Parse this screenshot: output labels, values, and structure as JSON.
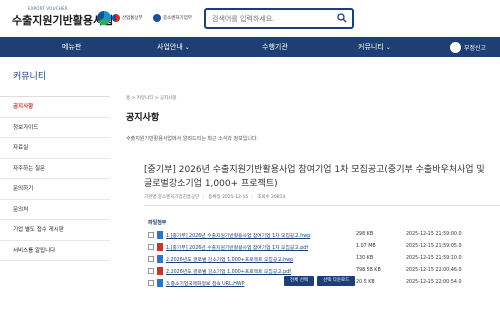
{
  "header": {
    "logo_small": "EXPORT VOUCHER",
    "logo_main": "수출지원기반활용사업",
    "gov1": "산업통상부",
    "gov2": "중소벤처기업부",
    "search_placeholder": "검색어를 입력하세요."
  },
  "nav": {
    "items": [
      "메뉴판",
      "사업안내",
      "수행기관",
      "커뮤니티"
    ],
    "util_label": "부정신고"
  },
  "sidebar": {
    "title": "커뮤니티",
    "items": [
      "공지사항",
      "정보가이드",
      "자료실",
      "자주하는 질문",
      "문의하기",
      "문의처",
      "기업 별도 접수 게시판",
      "서비스를 알립니다"
    ],
    "active_index": 0
  },
  "main": {
    "breadcrumb": "홈 > 커뮤니티 > 공지사항",
    "page_title": "공지사항",
    "page_desc": "수출지원기반활용사업에서 알려드리는 최근 소식과 정보입니다.",
    "board_title": "[중기부] 2026년 수출지원기반활용사업 참여기업 1차 모집공고(중기부 수출바우처사업 및 글로벌강소기업 1,000+ 프로젝트)",
    "meta": {
      "author": "기관명 중소벤처기업진흥공단",
      "date": "등록일 2025-12-15",
      "views": "조회수 20814"
    },
    "files_heading": "파일첨부",
    "files": [
      {
        "name": "1.[중기부] 2026년 수출지원기반활용사업 참여기업 1차 모집공고.hwp",
        "size": "298 KB",
        "date": "2025-12-15 21:59:00.0",
        "icon": "hwp-icon"
      },
      {
        "name": "1.[중기부] 2026년 수출지원기반활용사업 참여기업 1차 모집공고.pdf",
        "size": "1.07 MB",
        "date": "2025-12-15 21:59:05.0",
        "icon": "pdf-icon"
      },
      {
        "name": "2.2026년도 글로벌 강소기업 1,000+프로젝트 모집공고.hwp",
        "size": "130 KB",
        "date": "2025-12-15 21:59:10.0",
        "icon": "hwp-icon"
      },
      {
        "name": "2.2026년도 글로벌 강소기업 1,000+프로젝트 모집공고.pdf",
        "size": "798.58 KB",
        "date": "2025-12-15 22:00:46.0",
        "icon": "pdf-icon"
      },
      {
        "name": "3.중소기업국제화정보 접속 URL.HWP",
        "size": "20.5 KB",
        "date": "2025-12-15 22:00:54.0",
        "icon": "hwp-icon"
      }
    ],
    "btn_select_all": "전체 선택",
    "btn_download": "선택 다운로드"
  },
  "colors": {
    "navy": "#1d3f73",
    "active": "#c0392b"
  }
}
